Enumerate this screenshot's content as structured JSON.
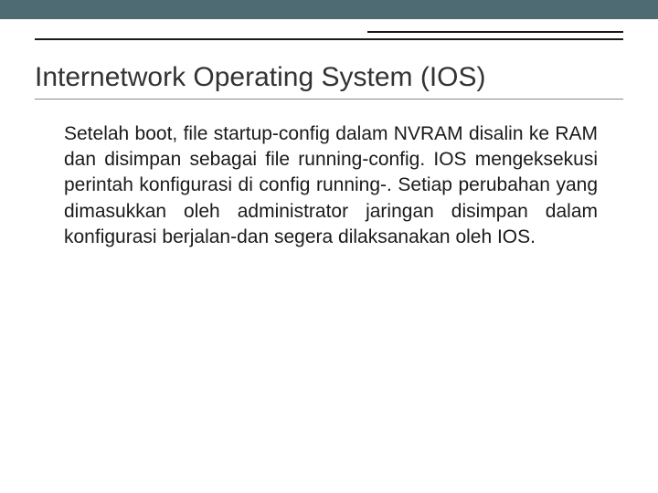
{
  "title": "Internetwork Operating System (IOS)",
  "body": "Setelah boot, file startup-config dalam NVRAM disalin ke RAM dan disimpan sebagai file running-config. IOS mengeksekusi perintah konfigurasi di config running-. Setiap perubahan yang dimasukkan oleh administrator jaringan disimpan dalam konfigurasi berjalan-dan segera dilaksanakan oleh IOS."
}
